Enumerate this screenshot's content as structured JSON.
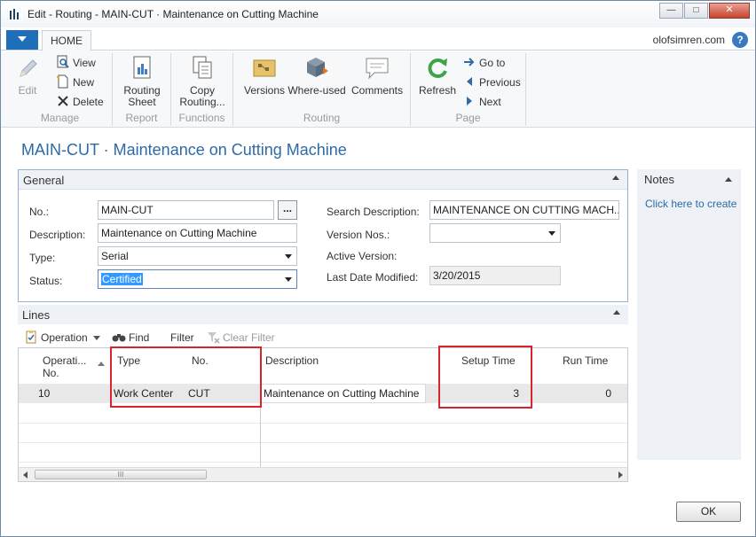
{
  "window": {
    "title": "Edit - Routing - MAIN-CUT · Maintenance on Cutting Machine",
    "minimize": "—",
    "maximize": "□",
    "close": "✕"
  },
  "ribbon": {
    "tab_home": "HOME",
    "user": "olofsimren.com",
    "help": "?",
    "groups": {
      "manage": {
        "label": "Manage",
        "edit": "Edit",
        "view": "View",
        "new": "New",
        "delete": "Delete"
      },
      "report": {
        "label": "Report",
        "routing_sheet_1": "Routing",
        "routing_sheet_2": "Sheet"
      },
      "functions": {
        "label": "Functions",
        "copy_routing_1": "Copy",
        "copy_routing_2": "Routing..."
      },
      "routing": {
        "label": "Routing",
        "versions": "Versions",
        "where_used": "Where-used",
        "comments": "Comments"
      },
      "page": {
        "label": "Page",
        "refresh": "Refresh",
        "goto": "Go to",
        "previous": "Previous",
        "next": "Next"
      }
    }
  },
  "page_title": "MAIN-CUT · Maintenance on Cutting Machine",
  "general": {
    "header": "General",
    "no_label": "No.:",
    "no_value": "MAIN-CUT",
    "no_assist": "...",
    "description_label": "Description:",
    "description_value": "Maintenance on Cutting Machine",
    "type_label": "Type:",
    "type_value": "Serial",
    "status_label": "Status:",
    "status_value": "Certified",
    "search_description_label": "Search Description:",
    "search_description_value": "MAINTENANCE ON CUTTING MACH...",
    "version_nos_label": "Version Nos.:",
    "version_nos_value": "",
    "active_version_label": "Active Version:",
    "last_date_modified_label": "Last Date Modified:",
    "last_date_modified_value": "3/20/2015"
  },
  "lines": {
    "header": "Lines",
    "toolbar": {
      "operation": "Operation",
      "find": "Find",
      "filter": "Filter",
      "clear_filter": "Clear Filter"
    },
    "columns": {
      "operation_no_1": "Operati...",
      "operation_no_2": "No.",
      "type": "Type",
      "no": "No.",
      "description": "Description",
      "setup_time": "Setup Time",
      "run_time": "Run Time"
    },
    "rows": [
      {
        "operation_no": "10",
        "type": "Work Center",
        "no": "CUT",
        "description": "Maintenance on Cutting Machine",
        "setup_time": "3",
        "run_time": "0"
      }
    ],
    "scroll_grip": "III"
  },
  "notes": {
    "header": "Notes",
    "link": "Click here to create a new note."
  },
  "ok_label": "OK"
}
